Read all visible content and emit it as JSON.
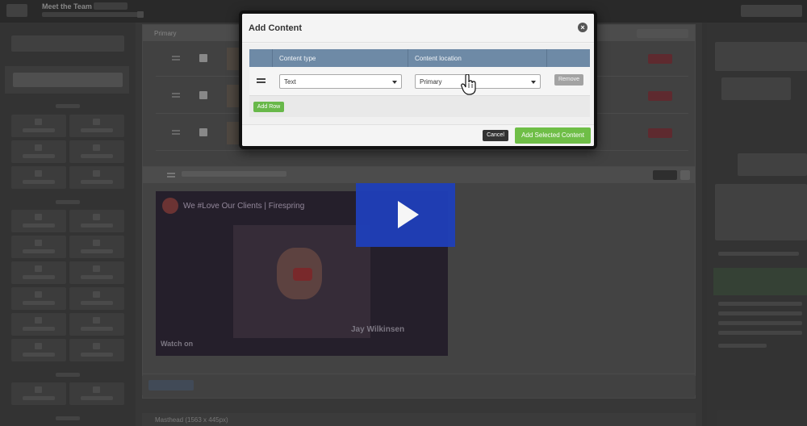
{
  "colors": {
    "table_header": "#6e8aa6",
    "add_button": "#6fbe47",
    "cancel_button": "#333333",
    "remove_button": "#a3a3a3",
    "play_overlay": "#1f3fb8"
  },
  "background": {
    "page_title": "Meet the Team",
    "section_title": "Primary",
    "video_title": "We #Love Our Clients | Firespring",
    "video_person": "Jay Wilkinsen",
    "video_watch": "Watch on",
    "masthead": "Masthead (1563 x 445px)"
  },
  "modal": {
    "title": "Add Content",
    "close_icon": "close-icon",
    "table": {
      "headers": [
        "Content type",
        "Content location"
      ],
      "rows": [
        {
          "content_type": "Text",
          "content_location": "Primary",
          "remove_label": "Remove"
        }
      ]
    },
    "add_row_label": "Add Row",
    "cancel_label": "Cancel",
    "add_selected_label": "Add Selected Content"
  },
  "overlay": {
    "play_icon": "play-icon"
  }
}
